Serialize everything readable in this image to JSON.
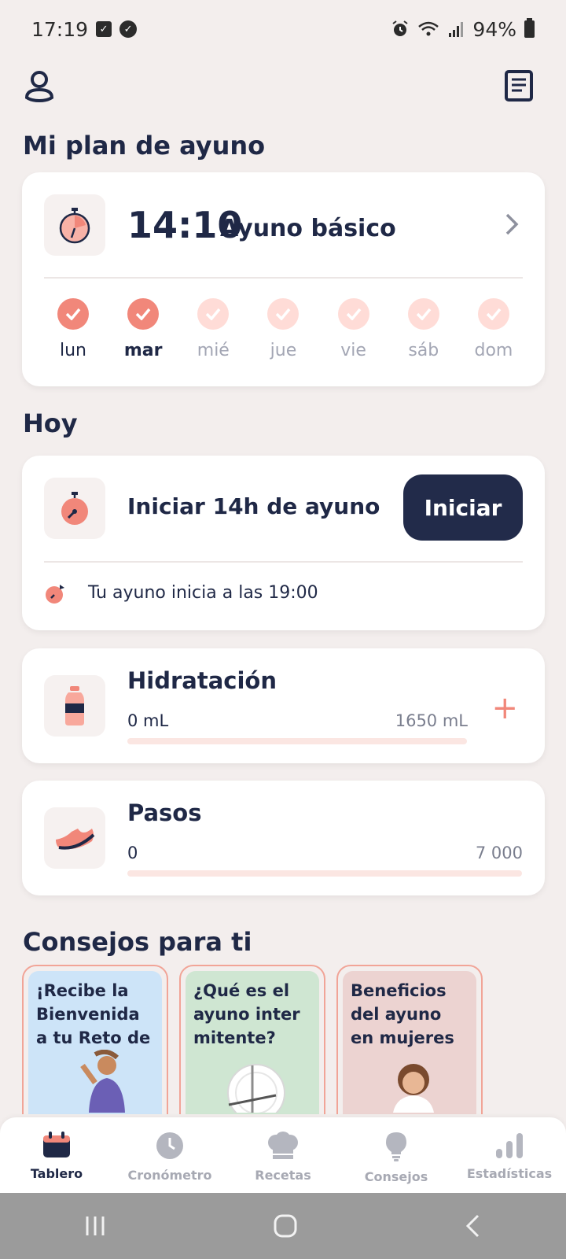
{
  "status": {
    "time": "17:19",
    "battery": "94%"
  },
  "plan_section": {
    "title": "Mi plan de ayuno",
    "ratio": "14:10",
    "name": "Ayuno básico",
    "days": [
      {
        "label": "lun",
        "done": true
      },
      {
        "label": "mar",
        "done": true,
        "today": true
      },
      {
        "label": "mié",
        "done": false
      },
      {
        "label": "jue",
        "done": false
      },
      {
        "label": "vie",
        "done": false
      },
      {
        "label": "sáb",
        "done": false
      },
      {
        "label": "dom",
        "done": false
      }
    ]
  },
  "today_section": {
    "title": "Hoy",
    "fast_title": "Iniciar 14h de ayuno",
    "start_label": "Iniciar",
    "note": "Tu ayuno inicia a las 19:00"
  },
  "hydration": {
    "title": "Hidratación",
    "current": "0 mL",
    "goal": "1650 mL",
    "progress": 0
  },
  "steps": {
    "title": "Pasos",
    "current": "0",
    "goal": "7 000",
    "progress": 0
  },
  "tips_section": {
    "title": "Consejos para ti",
    "cards": [
      {
        "text": "¡Recibe la Bienvenida a tu Reto de",
        "bg": "#cde4f8"
      },
      {
        "text": "¿Qué es el ayuno inter mitente?",
        "bg": "#cfe6d2"
      },
      {
        "text": "Beneficios del ayuno en mujeres",
        "bg": "#ecd3d1"
      }
    ]
  },
  "nav": {
    "items": [
      {
        "label": "Tablero",
        "icon": "calendar-icon",
        "active": true
      },
      {
        "label": "Cronómetro",
        "icon": "clock-icon"
      },
      {
        "label": "Recetas",
        "icon": "chef-hat-icon"
      },
      {
        "label": "Consejos",
        "icon": "lightbulb-icon"
      },
      {
        "label": "Estadísticas",
        "icon": "bar-chart-icon"
      }
    ]
  },
  "colors": {
    "accent": "#f1877a",
    "navy": "#222b4a",
    "background": "#f3eeed"
  }
}
